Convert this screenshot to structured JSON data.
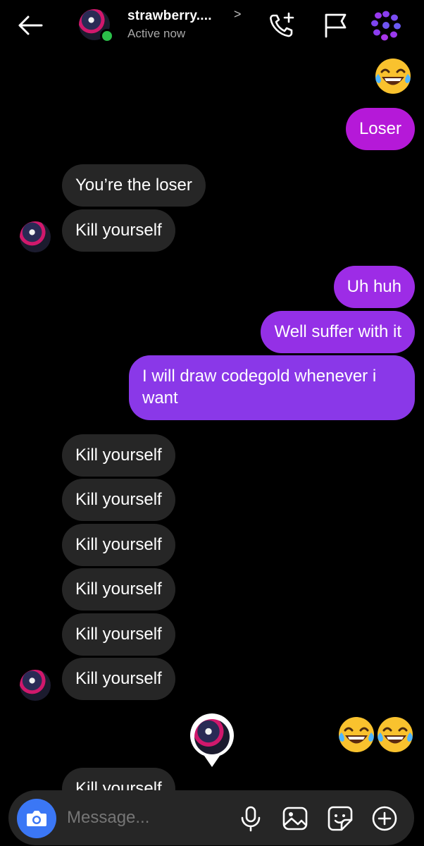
{
  "header": {
    "contact_name": "strawberry....",
    "chevron": ">",
    "status": "Active now"
  },
  "messages": [
    {
      "side": "sent",
      "kind": "emoji",
      "count": 1
    },
    {
      "side": "sent",
      "text": "Loser",
      "color": "#b519d8"
    },
    {
      "side": "received",
      "text": "You’re the loser"
    },
    {
      "side": "received",
      "text": "Kill yourself"
    },
    {
      "side": "sent",
      "text": "Uh huh",
      "color": "#9d2ce6"
    },
    {
      "side": "sent",
      "text": "Well suffer with it",
      "color": "#9430e6"
    },
    {
      "side": "sent",
      "lines": [
        "I will draw codegold whenever i",
        "want"
      ],
      "color": "#8a38e8"
    },
    {
      "side": "received",
      "text": "Kill yourself"
    },
    {
      "side": "received",
      "text": "Kill yourself"
    },
    {
      "side": "received",
      "text": "Kill yourself"
    },
    {
      "side": "received",
      "text": "Kill yourself"
    },
    {
      "side": "received",
      "text": "Kill yourself"
    },
    {
      "side": "received",
      "text": "Kill yourself"
    },
    {
      "side": "sent",
      "kind": "emoji",
      "count": 2
    },
    {
      "side": "received",
      "text": "Kill yourself",
      "partially_visible": true
    }
  ],
  "composer": {
    "placeholder": "Message..."
  },
  "colors": {
    "background": "#000000",
    "received_bubble": "#262626",
    "composer_bg": "#262626",
    "camera_button": "#3b77f5",
    "online_dot": "#2bc04a"
  },
  "icons": [
    "back-arrow-icon",
    "add-call-icon",
    "flag-icon",
    "theme-flower-icon",
    "camera-icon",
    "microphone-icon",
    "gallery-icon",
    "sticker-icon",
    "plus-circle-icon",
    "laughing-emoji-icon"
  ]
}
